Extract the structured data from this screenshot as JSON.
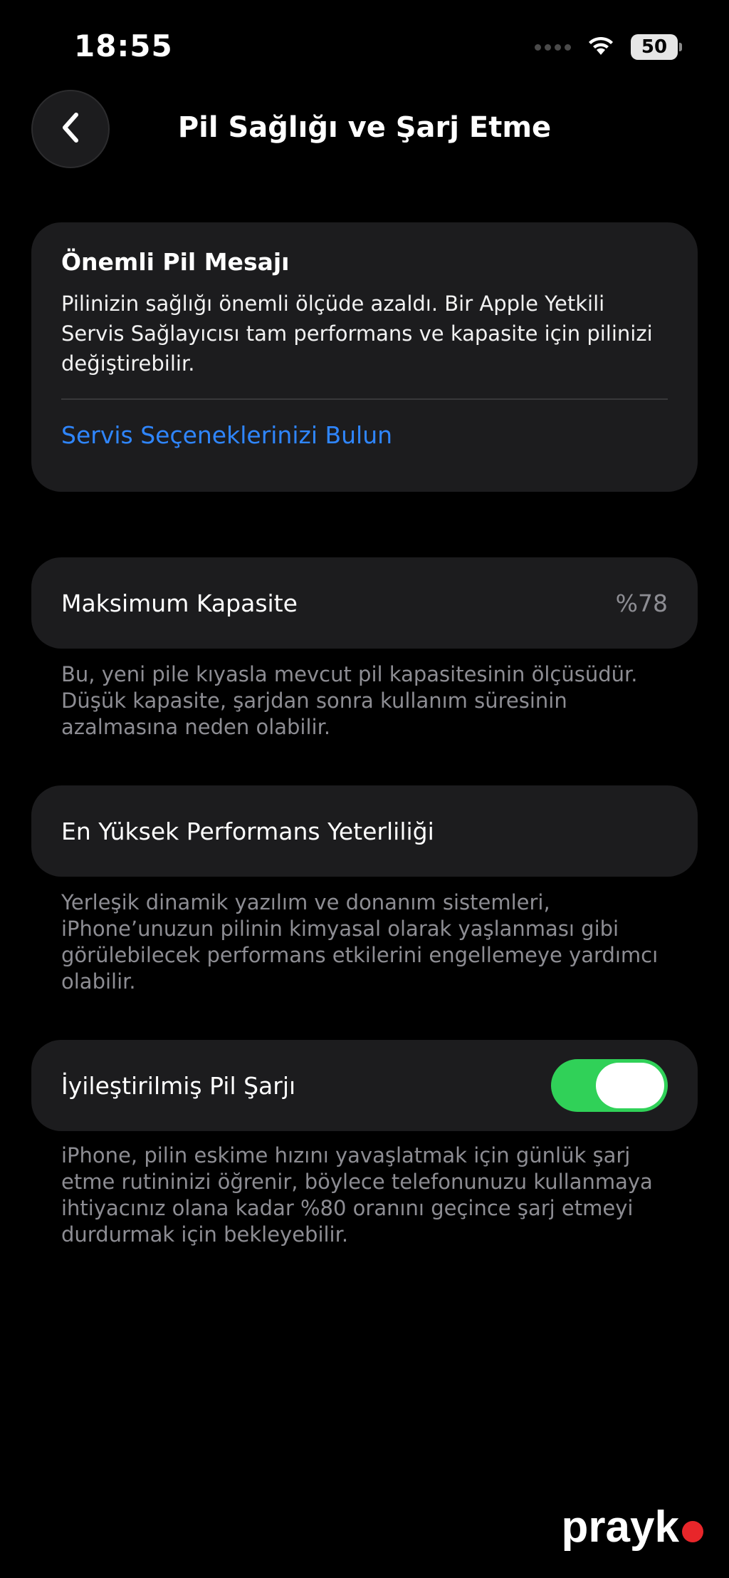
{
  "status_bar": {
    "time": "18:55",
    "battery_level": "50"
  },
  "nav": {
    "title": "Pil Sağlığı ve Şarj Etme"
  },
  "message_card": {
    "title": "Önemli Pil Mesajı",
    "body": "Pilinizin sağlığı önemli ölçüde azaldı. Bir Apple Yetkili Servis Sağlayıcısı tam performans ve kapasite için pilinizi değiştirebilir.",
    "link": "Servis Seçeneklerinizi Bulun"
  },
  "max_capacity": {
    "label": "Maksimum Kapasite",
    "value": "%78",
    "footer": "Bu, yeni pile kıyasla mevcut pil kapasitesinin ölçüsüdür. Düşük kapasite, şarjdan sonra kullanım süresinin azalmasına neden olabilir."
  },
  "peak_performance": {
    "label": "En Yüksek Performans Yeterliliği",
    "footer": "Yerleşik dinamik yazılım ve donanım sistemleri, iPhone’unuzun pilinin kimyasal olarak yaşlanması gibi görülebilecek performans etkilerini engellemeye yardımcı olabilir."
  },
  "optimized_charging": {
    "label": "İyileştirilmiş Pil Şarjı",
    "enabled": true,
    "footer": "iPhone, pilin eskime hızını yavaşlatmak için günlük şarj etme rutininizi öğrenir, böylece telefonunuzu kullanmaya ihtiyacınız olana kadar %80 oranını geçince şarj etmeyi durdurmak için bekleyebilir."
  },
  "watermark": {
    "text": "prayk"
  },
  "colors": {
    "background": "#000000",
    "card": "#1c1c1e",
    "link": "#2f86ff",
    "toggle_on": "#30d158",
    "secondary_text": "#8d8d93"
  }
}
